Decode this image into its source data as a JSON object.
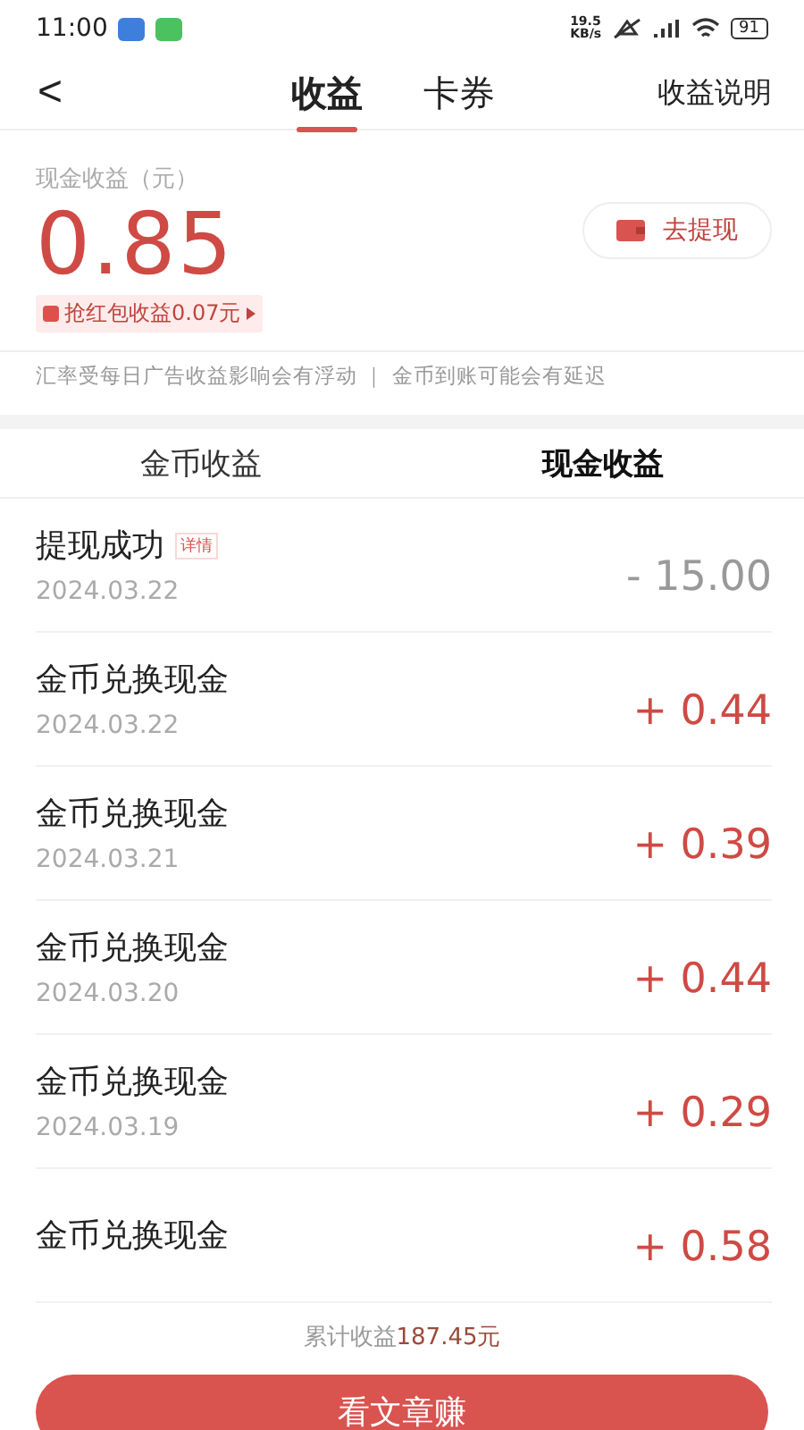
{
  "status_bar": {
    "time": "11:00",
    "speed": "19.5",
    "speed_unit": "KB/s",
    "battery": "91"
  },
  "header": {
    "back": "<",
    "tabs": [
      {
        "label": "收益",
        "selected": true
      },
      {
        "label": "卡券",
        "selected": false
      }
    ],
    "help": "收益说明"
  },
  "balance": {
    "label": "现金收益（元）",
    "amount": "0.85",
    "withdraw_button": "去提现",
    "red_packet": "抢红包收益0.07元"
  },
  "notice": "汇率受每日广告收益影响会有浮动 ｜ 金币到账可能会有延迟",
  "sub_tabs": [
    {
      "label": "金币收益",
      "selected": false
    },
    {
      "label": "现金收益",
      "selected": true
    }
  ],
  "records": [
    {
      "kind": "withdraw",
      "title": "提现成功",
      "tag": "详情",
      "date": "2024.03.22",
      "amount": "- 15.00"
    },
    {
      "kind": "exchange",
      "title": "金币兑换现金",
      "date": "2024.03.22",
      "amount": "+ 0.44"
    },
    {
      "kind": "exchange",
      "title": "金币兑换现金",
      "date": "2024.03.21",
      "amount": "+ 0.39"
    },
    {
      "kind": "exchange",
      "title": "金币兑换现金",
      "date": "2024.03.20",
      "amount": "+ 0.44"
    },
    {
      "kind": "exchange",
      "title": "金币兑换现金",
      "date": "2024.03.19",
      "amount": "+ 0.29"
    },
    {
      "kind": "exchange",
      "title": "金币兑换现金",
      "amount": "+ 0.58"
    }
  ],
  "footer": {
    "total_label": "累计收益",
    "total_amount": "187.45元",
    "button": "看文章赚"
  }
}
